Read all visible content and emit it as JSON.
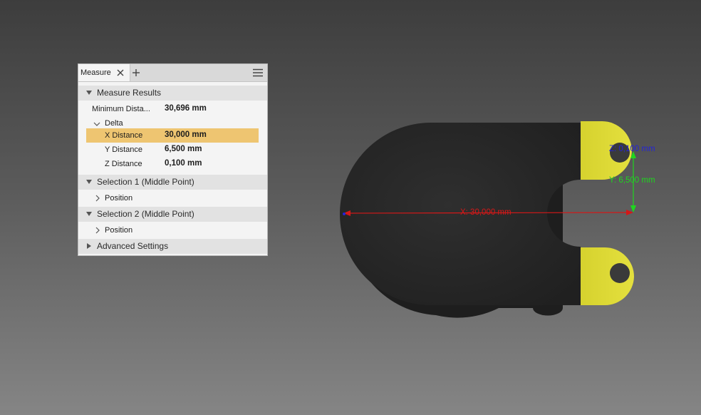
{
  "panel": {
    "tab_label": "Measure",
    "sections": {
      "results": "Measure Results",
      "selection1": "Selection 1 (Middle Point)",
      "selection2": "Selection 2 (Middle Point)",
      "advanced": "Advanced Settings"
    },
    "minimum_distance": {
      "label": "Minimum Dista...",
      "value": "30,696 mm"
    },
    "delta": {
      "label": "Delta",
      "rows": [
        {
          "label": "X Distance",
          "value": "30,000 mm",
          "selected": true
        },
        {
          "label": "Y Distance",
          "value": "6,500 mm",
          "selected": false
        },
        {
          "label": "Z Distance",
          "value": "0,100 mm",
          "selected": false
        }
      ]
    },
    "selection1_position": "Position",
    "selection2_position": "Position"
  },
  "viewport": {
    "dimensions": {
      "x": "X: 30,000 mm",
      "y": "Y: 6,500 mm",
      "z": "Z: 0,100 mm"
    },
    "colors": {
      "x_axis": "#d41818",
      "y_axis": "#1fd61f",
      "z_axis": "#2424d8",
      "highlight": "#e2de3a",
      "part": "#2c2c2c",
      "selected_row": "#eec571"
    }
  }
}
